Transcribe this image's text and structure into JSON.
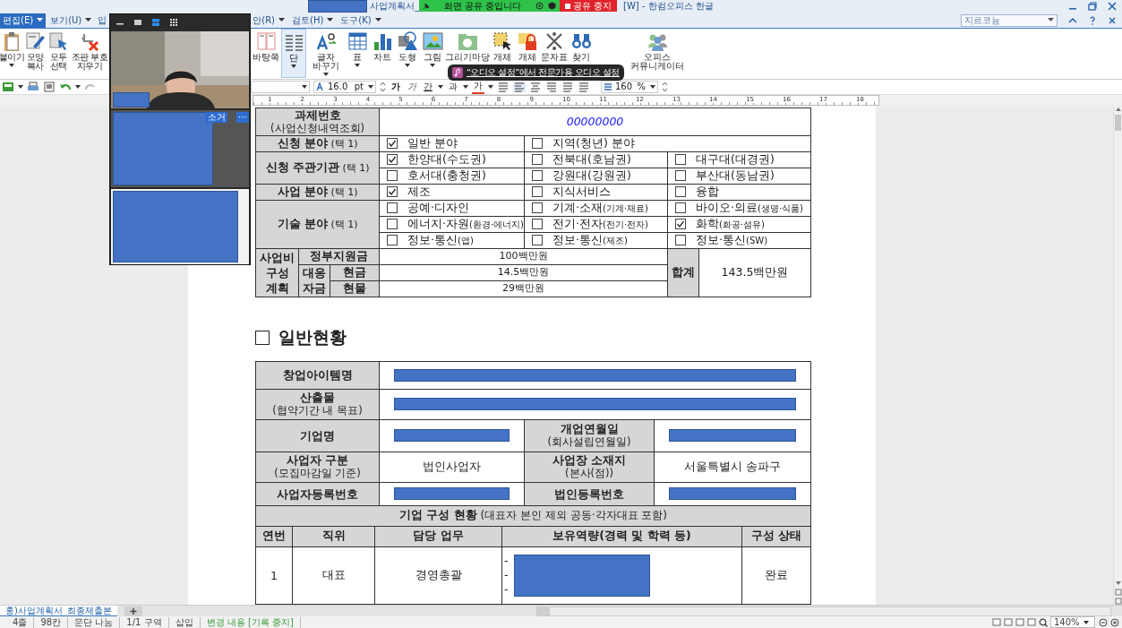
{
  "window": {
    "title_left": "사업계획서_",
    "title_right": "[W] - 한컴오피스 한글"
  },
  "menu": [
    {
      "label": "편집(E)",
      "selected": true
    },
    {
      "label": "보기(U)",
      "selected": false
    },
    {
      "label": "입",
      "selected": false
    },
    {
      "label": "안(R)",
      "selected": false
    },
    {
      "label": "검토(H)",
      "selected": false
    },
    {
      "label": "도구(K)",
      "selected": false
    }
  ],
  "help_search": {
    "value": "지르코늄"
  },
  "ribbon_left": [
    {
      "label": "붙이기",
      "caret": true,
      "selected": false
    },
    {
      "label": "모양 복사",
      "caret": false,
      "selected": false
    },
    {
      "label": "모두 선택",
      "caret": false,
      "selected": false
    },
    {
      "label": "조판 부호 지우기",
      "caret": false,
      "selected": false
    }
  ],
  "ribbon_right": [
    {
      "label": "바탕쪽",
      "caret": false,
      "selected": false
    },
    {
      "label": "단",
      "caret": true,
      "selected": true
    },
    {
      "label": "글자 바꾸기",
      "caret": true,
      "selected": false
    },
    {
      "label": "표",
      "caret": true,
      "selected": false
    },
    {
      "label": "차트",
      "caret": false,
      "selected": false
    },
    {
      "label": "도형",
      "caret": true,
      "selected": false
    },
    {
      "label": "그림",
      "caret": true,
      "selected": false
    },
    {
      "label": "그리기마당",
      "caret": false,
      "selected": false
    },
    {
      "label": "개체",
      "caret": false,
      "selected": false
    },
    {
      "label": "개체",
      "caret": false,
      "selected": false
    },
    {
      "label": "문자표",
      "caret": false,
      "selected": false
    },
    {
      "label": "찾기",
      "caret": false,
      "selected": false
    },
    {
      "label": "오피스 커뮤니케이터",
      "caret": false,
      "selected": false
    }
  ],
  "format_bar": {
    "font_size": "16.0",
    "unit": "pt",
    "char_buttons": [
      "가",
      "가",
      "간",
      "과",
      "가"
    ],
    "zoom": "160",
    "zoom_unit": "%"
  },
  "ruler": {
    "numbers": [
      "1",
      "2",
      "3",
      "4",
      "5",
      "6",
      "7",
      "8",
      "9",
      "10",
      "11",
      "12",
      "13",
      "14",
      "15",
      "16",
      "17",
      "18"
    ]
  },
  "application_table": {
    "task_number": {
      "label": "과제번호",
      "sublabel": "(사업신청내역조회)",
      "value": "00000000"
    },
    "groups": [
      {
        "label": "신청 분야",
        "hint": "(택 1)",
        "lines": [
          [
            {
              "text": "일반 분야",
              "checked": true
            },
            {
              "text": "지역(청년) 분야",
              "checked": false
            }
          ]
        ]
      },
      {
        "label": "신청 주관기관",
        "hint": "(택 1)",
        "lines": [
          [
            {
              "text": "한양대(수도권)",
              "checked": true
            },
            {
              "text": "전북대(호남권)",
              "checked": false
            },
            {
              "text": "대구대(대경권)",
              "checked": false
            }
          ],
          [
            {
              "text": "호서대(충청권)",
              "checked": false
            },
            {
              "text": "강원대(강원권)",
              "checked": false
            },
            {
              "text": "부산대(동남권)",
              "checked": false
            }
          ]
        ]
      },
      {
        "label": "사업 분야",
        "hint": "(택 1)",
        "lines": [
          [
            {
              "text": "제조",
              "checked": true
            },
            {
              "text": "지식서비스",
              "checked": false
            },
            {
              "text": "융합",
              "checked": false
            }
          ]
        ]
      },
      {
        "label": "기술 분야",
        "hint": "(택 1)",
        "lines": [
          [
            {
              "text": "공예·디자인",
              "checked": false
            },
            {
              "text": "기계·소재",
              "note": "(기계·재료)",
              "checked": false
            },
            {
              "text": "바이오·의료",
              "note": "(생명·식품)",
              "checked": false
            }
          ],
          [
            {
              "text": "에너지·자원",
              "note": "(환경·에너지)",
              "checked": false
            },
            {
              "text": "전기·전자",
              "note": "(전기·전자)",
              "checked": false
            },
            {
              "text": "화학",
              "note": "(화공·섬유)",
              "checked": true
            }
          ],
          [
            {
              "text": "정보·통신",
              "note": "(앱)",
              "checked": false
            },
            {
              "text": "정보·통신",
              "note": "(제조)",
              "checked": false
            },
            {
              "text": "정보·통신",
              "note": "(SW)",
              "checked": false
            }
          ]
        ]
      }
    ],
    "budget": {
      "label": "사업비 구성 계획",
      "government": {
        "label": "정부지원금",
        "value": "100백만원"
      },
      "matching": {
        "label": "대응 자금",
        "cash": {
          "label": "현금",
          "value": "14.5백만원"
        },
        "in_kind": {
          "label": "현물",
          "value": "29백만원"
        }
      },
      "total": {
        "label": "합계",
        "value": "143.5백만원"
      }
    }
  },
  "general": {
    "heading": "일반현황",
    "rows": [
      [
        {
          "kind": "label",
          "text": "창업아이템명"
        },
        {
          "kind": "redacted"
        }
      ],
      [
        {
          "kind": "label",
          "text": "산출물",
          "sub": "(협약기간 내 목표)"
        },
        {
          "kind": "redacted"
        }
      ],
      [
        {
          "kind": "label",
          "text": "기업명"
        },
        {
          "kind": "redacted"
        },
        {
          "kind": "label",
          "text": "개업연월일",
          "sub": "(회사설립연월일)"
        },
        {
          "kind": "redacted"
        }
      ],
      [
        {
          "kind": "label",
          "text": "사업자 구분",
          "sub": "(모집마감일 기준)"
        },
        {
          "kind": "value",
          "text": "법인사업자"
        },
        {
          "kind": "label",
          "text": "사업장 소재지",
          "sub": "(본사(점))"
        },
        {
          "kind": "value",
          "text": "서울특별시 송파구"
        }
      ],
      [
        {
          "kind": "label",
          "text": "사업자등록번호"
        },
        {
          "kind": "redacted"
        },
        {
          "kind": "label",
          "text": "법인등록번호"
        },
        {
          "kind": "redacted"
        }
      ]
    ],
    "members": {
      "title": "기업 구성 현황",
      "title_note": "(대표자 본인 제외 공동·각자대표 포함)",
      "columns": [
        "연번",
        "직위",
        "담당 업무",
        "보유역량(경력 및 학력 등)",
        "구성 상태"
      ],
      "rows": [
        {
          "number": "1",
          "position": "대표",
          "duty": "경영총괄",
          "bullets": [
            "-",
            "-",
            "-"
          ],
          "status": "완료"
        }
      ]
    }
  },
  "doc_tabs": [
    {
      "label": "홍)사업계획서_최종제출본",
      "selected": true
    }
  ],
  "status_bar": [
    "4줄",
    "98칸",
    "문단 나눔",
    "1/1 구역",
    "삽입",
    "변경 내용 [기록 중지]"
  ],
  "status_zoom": "140%",
  "video_call": {
    "mute_label": "소거",
    "more": "···"
  },
  "share_banner": {
    "text": "화면 공유 중입니다",
    "stop": "공유 중지"
  },
  "tooltip": {
    "text": "“오디오 설정”에서 전문가용 오디오 설정"
  }
}
